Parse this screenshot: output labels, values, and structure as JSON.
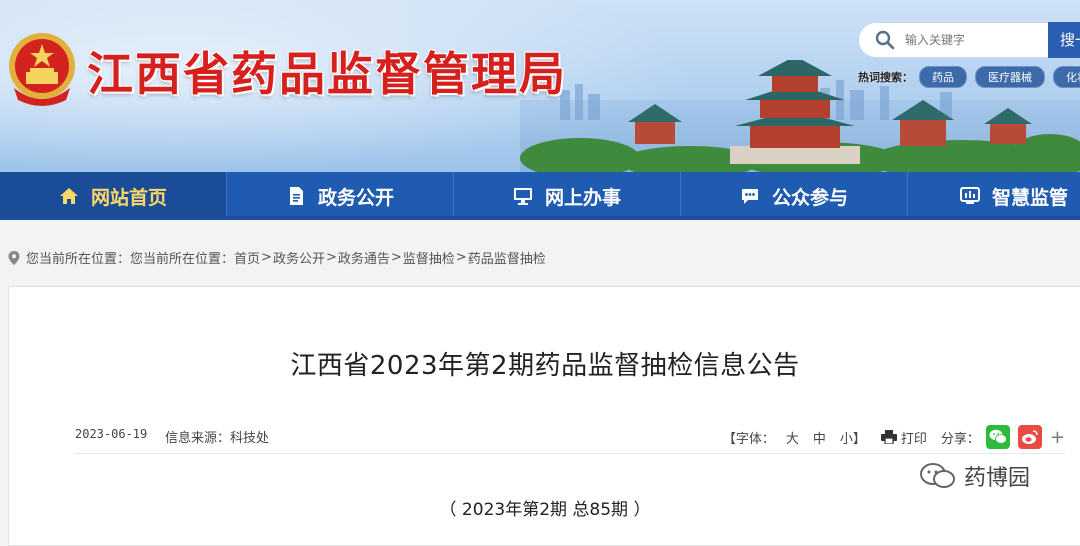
{
  "header": {
    "site_title": "江西省药品监督管理局",
    "search": {
      "placeholder": "输入关键字",
      "button_label": "搜一"
    },
    "hotwords": {
      "label": "热词搜索：",
      "tags": [
        "药品",
        "医疗器械",
        "化妆"
      ]
    }
  },
  "nav": {
    "items": [
      {
        "label": "网站首页",
        "icon": "home-icon"
      },
      {
        "label": "政务公开",
        "icon": "document-icon"
      },
      {
        "label": "网上办事",
        "icon": "monitor-icon"
      },
      {
        "label": "公众参与",
        "icon": "chat-icon"
      },
      {
        "label": "智慧监管",
        "icon": "screen-icon"
      }
    ],
    "active_index": 0
  },
  "breadcrumb": {
    "prefix": "您当前所在位置：您当前所在位置：",
    "items": [
      "首页",
      "政务公开",
      "政务通告",
      "监督抽检",
      "药品监督抽检"
    ]
  },
  "article": {
    "title": "江西省2023年第2期药品监督抽检信息公告",
    "date": "2023-06-19",
    "source": "信息来源：科技处",
    "font_size_label": "【字体：",
    "font_size_options": [
      "大",
      "中",
      "小】"
    ],
    "print_label": "打印",
    "share_label": "分享：",
    "plus": "+",
    "issue_line": "（ 2023年第2期 总85期 ）"
  },
  "watermark": {
    "text": "药博园"
  },
  "colors": {
    "title_red": "#d6201d",
    "nav_blue": "#1f5bb1",
    "nav_active_text": "#ffd966",
    "wechat_green": "#2dbb3e",
    "weibo_red": "#e84a44"
  }
}
